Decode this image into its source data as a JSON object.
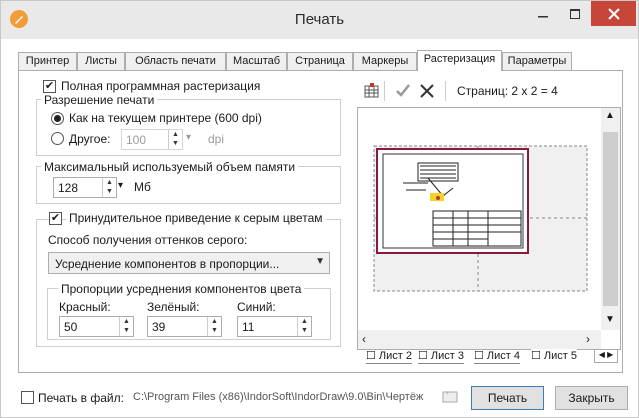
{
  "window": {
    "title": "Печать"
  },
  "tabs": [
    "Принтер",
    "Листы",
    "Область печати",
    "Масштаб",
    "Страница",
    "Маркеры",
    "Растеризация",
    "Параметры"
  ],
  "active_tab": "Растеризация",
  "raster": {
    "full_label": "Полная программная растеризация",
    "resolution_group": "Разрешение печати",
    "option_current": "Как на текущем принтере (600 dpi)",
    "option_other": "Другое:",
    "other_value": "100",
    "other_unit": "dpi",
    "memory_group": "Максимальный используемый объем памяти",
    "memory_value": "128",
    "memory_unit": "Мб",
    "gray_label": "Принудительное приведение к серым цветам",
    "gray_method_label": "Способ получения оттенков серого:",
    "gray_method_value": "Усреднение компонентов в пропорции...",
    "proportions_group": "Пропорции усреднения компонентов цвета",
    "red_label": "Красный:",
    "red_value": "50",
    "green_label": "Зелёный:",
    "green_value": "39",
    "blue_label": "Синий:",
    "blue_value": "11"
  },
  "preview": {
    "pages_text": "Страниц: 2 x 2 = 4",
    "sheets": [
      "Лист 2",
      "Лист 3",
      "Лист 4",
      "Лист 5"
    ],
    "active_sheet": "Лист 5"
  },
  "footer": {
    "print_to_file": "Печать в файл:",
    "path": "C:\\Program Files (x86)\\IndorSoft\\IndorDraw\\9.0\\Bin\\Чертёж",
    "print_button": "Печать",
    "close_button": "Закрыть"
  },
  "colors": {
    "close": "#c7463a",
    "page_border": "#8b1a3a",
    "accent": "#f29c38"
  }
}
